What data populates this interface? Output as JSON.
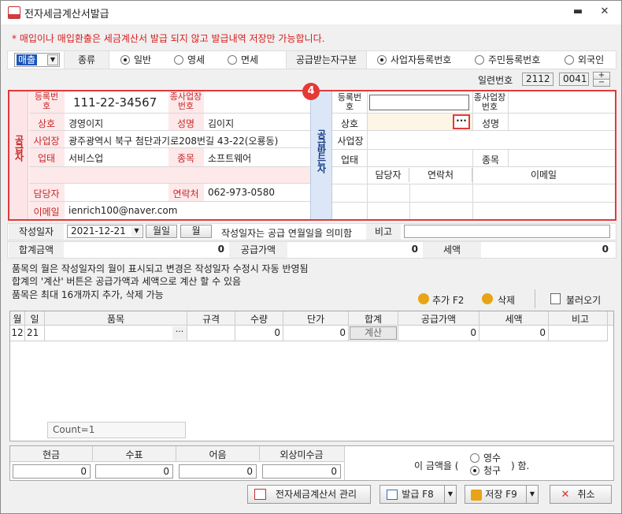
{
  "window": {
    "title": "전자세금계산서발급",
    "minimize": "▬",
    "close": "✕"
  },
  "notice": "* 매입이나 매입환출은 세금계산서 발급 되지 않고 발급내역 저장만 가능합니다.",
  "top": {
    "type_select": "매출",
    "kind_label": "종류",
    "kind_options": [
      "일반",
      "영세",
      "면세"
    ],
    "kind_selected": 0,
    "buyer_type_label": "공급받는자구분",
    "buyer_type_options": [
      "사업자등록번호",
      "주민등록번호",
      "외국인"
    ],
    "buyer_type_selected": 0
  },
  "serial": {
    "label": "일련번호",
    "value1": "2112",
    "value2": "0041",
    "up": "+",
    "down": "−"
  },
  "badge": "4",
  "supplier": {
    "header": "공급자",
    "reg_no_label": "등록번호",
    "reg_no": "111-22-34567",
    "sub_reg_label": "종사업장번호",
    "sub_reg": "",
    "name_label": "상호",
    "name": "경영이지",
    "ceo_label": "성명",
    "ceo": "김이지",
    "addr_label": "사업장",
    "addr": "광주광역시 북구 첨단과기로208번길 43-22(오룡동)",
    "biz_type_label": "업태",
    "biz_type": "서비스업",
    "biz_item_label": "종목",
    "biz_item": "소프트웨어",
    "manager_label": "담당자",
    "manager": "",
    "contact_label": "연락처",
    "contact": "062-973-0580",
    "email_label": "이메일",
    "email": "ienrich100@naver.com"
  },
  "buyer": {
    "header": "공급받는자",
    "reg_no_label": "등록번호",
    "sub_reg_label": "종사업장번호",
    "name_label": "상호",
    "ceo_label": "성명",
    "lookup": "···",
    "addr_label": "사업장",
    "biz_type_label": "업태",
    "biz_item_label": "종목",
    "col_manager": "담당자",
    "col_contact": "연락처",
    "col_email": "이메일"
  },
  "date_row": {
    "label": "작성일자",
    "date": "2021-12-21",
    "month_day": "월일",
    "month": "월",
    "hint": "작성일자는 공급 연월일을 의미함",
    "memo_label": "비고"
  },
  "totals": {
    "total_label": "합계금액",
    "total": "0",
    "supply_label": "공급가액",
    "supply": "0",
    "tax_label": "세액",
    "tax": "0"
  },
  "info_lines": [
    "품목의 월은 작성일자의 월이 표시되고 변경은 작성일자 수정시 자동 반영됨",
    "합계의 '계산' 버튼은 공급가액과 세액으로 계산 할 수 있음",
    "품목은 최대 16개까지 추가, 삭제 가능"
  ],
  "item_buttons": {
    "add": "추가 F2",
    "delete": "삭제",
    "load": "불러오기"
  },
  "item_table": {
    "columns": [
      "월",
      "일",
      "품목",
      "규격",
      "수량",
      "단가",
      "합계",
      "공급가액",
      "세액",
      "비고"
    ],
    "row": {
      "month": "12",
      "day": "21",
      "item": "",
      "spec": "",
      "qty": "0",
      "price": "0",
      "calc": "계산",
      "supply": "0",
      "tax": "0",
      "memo": ""
    },
    "count": "Count=1"
  },
  "payment": {
    "cols": [
      "현금",
      "수표",
      "어음",
      "외상미수금"
    ],
    "values": [
      "0",
      "0",
      "0",
      "0"
    ],
    "phrase_pre": "이 금액을 (",
    "phrase_post": ") 함.",
    "opt1": "영수",
    "opt2": "청구",
    "selected": 1
  },
  "actions": {
    "manage": "전자세금계산서 관리",
    "issue": "발급 F8",
    "save": "저장 F9",
    "cancel": "취소"
  }
}
